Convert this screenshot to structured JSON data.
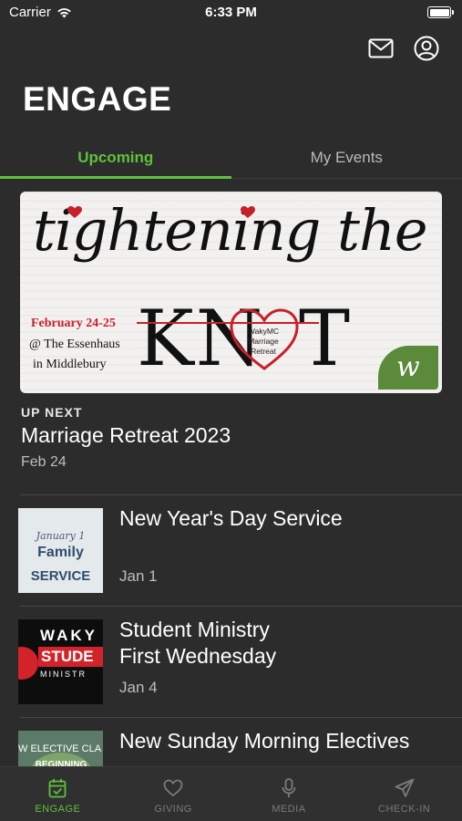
{
  "status_bar": {
    "carrier": "Carrier",
    "time": "6:33 PM"
  },
  "header": {
    "title": "ENGAGE",
    "icons": [
      "mail-icon",
      "account-icon"
    ]
  },
  "tabs": [
    {
      "label": "Upcoming",
      "active": true
    },
    {
      "label": "My Events",
      "active": false
    }
  ],
  "featured": {
    "banner": {
      "headline_script": "tightening the",
      "headline_knot": "KN",
      "headline_t": "T",
      "date": "February 24-25",
      "location_line1": "@ The Essenhaus",
      "location_line2": "in Middlebury",
      "heart_text": "WakyMC Marriage Retreat"
    },
    "label": "UP NEXT",
    "title": "Marriage Retreat 2023",
    "date": "Feb 24"
  },
  "events": [
    {
      "title": "New Year's Day Service",
      "date": "Jan 1",
      "thumb": {
        "line1": "January 1",
        "line2": "Family",
        "line3": "SERVICE"
      }
    },
    {
      "title": "Student Ministry First Wednesday",
      "date": "Jan 4",
      "thumb": {
        "line1": "WAKY",
        "line2": "STUDE",
        "line3": "MINISTR"
      }
    },
    {
      "title": "New Sunday Morning Electives",
      "date": "",
      "thumb": {
        "line1": "W ELECTIVE CLA",
        "line2": "BEGINNING"
      }
    }
  ],
  "tabbar": [
    {
      "label": "ENGAGE",
      "icon": "calendar-check-icon",
      "active": true
    },
    {
      "label": "GIVING",
      "icon": "heart-icon",
      "active": false
    },
    {
      "label": "MEDIA",
      "icon": "microphone-icon",
      "active": false
    },
    {
      "label": "CHECK-IN",
      "icon": "paper-plane-icon",
      "active": false
    }
  ],
  "colors": {
    "background": "#2c2c2c",
    "accent": "#5fc13a",
    "secondary_text": "#bdbdbd",
    "tab_inactive": "#7b7b7b"
  }
}
